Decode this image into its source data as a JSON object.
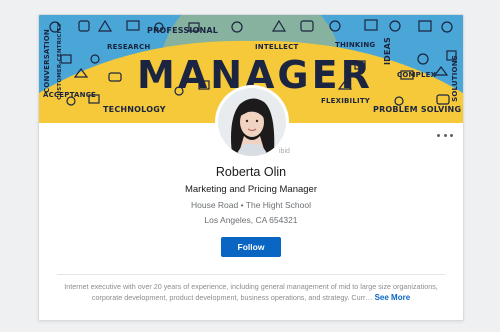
{
  "banner": {
    "headline": "MANAGER",
    "words": {
      "professional": "PROFESSIONAL",
      "research": "RESEARCH",
      "intellect": "INTELLECT",
      "thinking": "THINKING",
      "ideas": "IDEAS",
      "conversation": "CONVERSATION",
      "customer_centricity": "CUSTOMER-CENTRICITY",
      "acceptance": "ACCEPTANCE",
      "technology": "TECHNOLOGY",
      "flexibility": "FLEXIBILITY",
      "complex": "COMPLEX",
      "problem_solving": "PROBLEM SOLVING",
      "solutions": "SOLUTIONS"
    },
    "colors": {
      "sky": "#4aa6d6",
      "sun": "#f5c93a",
      "ink": "#1b2440"
    }
  },
  "profile": {
    "watermark": "ibid",
    "name": "Roberta Olin",
    "title": "Marketing and Pricing Manager",
    "organization": "House Road • The Hight School",
    "location": "Los Angeles, CA 654321",
    "follow_label": "Follow",
    "summary": "Internet executive with over 20 years of experience, including general management of mid to large size organizations, corporate development, product development, business operations, and strategy. Curr…",
    "see_more_label": "See More"
  },
  "icons": {
    "more": "more-horizontal-icon",
    "avatar": "profile-photo"
  },
  "colors": {
    "accent": "#0a66c2"
  }
}
